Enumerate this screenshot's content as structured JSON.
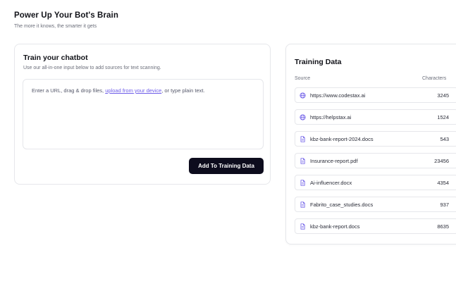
{
  "header": {
    "title": "Power Up Your Bot's Brain",
    "subtitle": "The more it knows, the smarter it gets"
  },
  "train": {
    "title": "Train your chatbot",
    "description": "Use our all-in-one input below to add sources for text scanning.",
    "placeholder_before": "Enter a URL, drag & drop files, ",
    "placeholder_link": "upload from your device",
    "placeholder_after": ", or type plain text.",
    "button_label": "Add To Training Data"
  },
  "training_data": {
    "title": "Training Data",
    "col_source": "Source",
    "col_characters": "Characters",
    "accent_color": "#6d5ce8",
    "rows": [
      {
        "icon": "globe-icon",
        "source": "https://www.codestax.ai",
        "characters": "3245"
      },
      {
        "icon": "globe-icon",
        "source": "https://helpstax.ai",
        "characters": "1524"
      },
      {
        "icon": "file-icon",
        "source": "kbz-bank-report-2024.docs",
        "characters": "543"
      },
      {
        "icon": "file-icon",
        "source": "Insurance-report.pdf",
        "characters": "23456"
      },
      {
        "icon": "file-icon",
        "source": "Ai-influencer.docx",
        "characters": "4354"
      },
      {
        "icon": "file-icon",
        "source": "Fabrito_case_studies.docs",
        "characters": "937"
      },
      {
        "icon": "file-icon",
        "source": "kbz-bank-report.docs",
        "characters": "8635"
      }
    ]
  }
}
